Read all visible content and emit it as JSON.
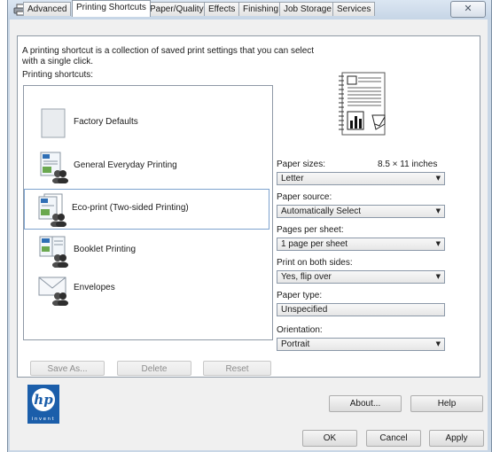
{
  "window": {
    "close_glyph": "✕"
  },
  "tabs": [
    {
      "label": "Advanced"
    },
    {
      "label": "Printing Shortcuts"
    },
    {
      "label": "Paper/Quality"
    },
    {
      "label": "Effects"
    },
    {
      "label": "Finishing"
    },
    {
      "label": "Job Storage"
    },
    {
      "label": "Services"
    }
  ],
  "active_tab": "Printing Shortcuts",
  "description": "A printing shortcut is a collection of saved print settings that you can select with a single click.",
  "shortcuts_label": "Printing shortcuts:",
  "shortcuts": [
    {
      "label": "Factory Defaults",
      "icon": "blank-page-icon"
    },
    {
      "label": "General Everyday Printing",
      "icon": "document-users-icon"
    },
    {
      "label": "Eco-print (Two-sided Printing)",
      "icon": "duplex-document-users-icon",
      "selected": true
    },
    {
      "label": "Booklet Printing",
      "icon": "booklet-users-icon"
    },
    {
      "label": "Envelopes",
      "icon": "envelope-users-icon"
    }
  ],
  "list_buttons": {
    "save_as": "Save As...",
    "delete": "Delete",
    "reset": "Reset"
  },
  "settings": {
    "paper_sizes": {
      "label": "Paper sizes:",
      "extra": "8.5 × 11 inches",
      "value": "Letter"
    },
    "paper_source": {
      "label": "Paper source:",
      "value": "Automatically Select"
    },
    "pages_per_sheet": {
      "label": "Pages per sheet:",
      "value": "1 page per sheet"
    },
    "print_both_sides": {
      "label": "Print on both sides:",
      "value": "Yes, flip over"
    },
    "paper_type": {
      "label": "Paper type:",
      "value": "Unspecified"
    },
    "orientation": {
      "label": "Orientation:",
      "value": "Portrait"
    }
  },
  "logo": {
    "brand": "hp",
    "tagline": "invent"
  },
  "footer": {
    "about": "About...",
    "help": "Help",
    "ok": "OK",
    "cancel": "Cancel",
    "apply": "Apply"
  },
  "colors": {
    "selection_border": "#7da2ce",
    "hp_blue": "#1b5eaa"
  }
}
